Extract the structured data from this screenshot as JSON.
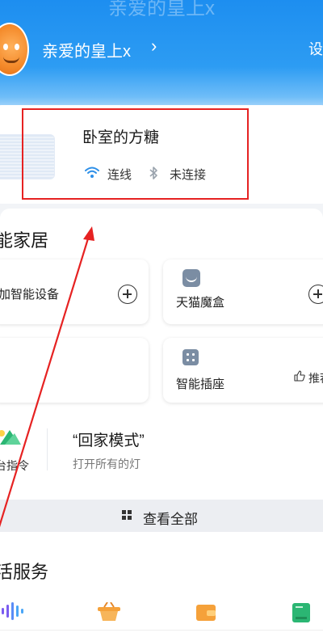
{
  "header": {
    "faded_title": "亲爱的皇上x",
    "user_name": "亲爱的皇上x",
    "chevron": "›",
    "settings_cut": "设"
  },
  "device": {
    "name": "卧室的方糖",
    "wifi_status": "连线",
    "bluetooth_status": "未连接"
  },
  "smart_home": {
    "title": "能家居",
    "tiles": [
      {
        "label": "加智能设备"
      },
      {
        "label": "天猫魔盒"
      },
      {
        "label": ""
      },
      {
        "label": "智能插座",
        "recommend": "推荐"
      }
    ],
    "scene": {
      "command_label": "台指令",
      "title": "“回家模式”",
      "subtitle": "打开所有的灯"
    }
  },
  "view_all": {
    "label": "查看全部"
  },
  "life_services": {
    "title": "活服务",
    "icons": [
      "music-wave-icon",
      "basket-icon",
      "wallet-icon",
      "book-icon"
    ]
  },
  "colors": {
    "header_blue": "#1d8ef0",
    "annotation_red": "#e62222",
    "orange": "#f5a13a",
    "green": "#2bb673"
  }
}
